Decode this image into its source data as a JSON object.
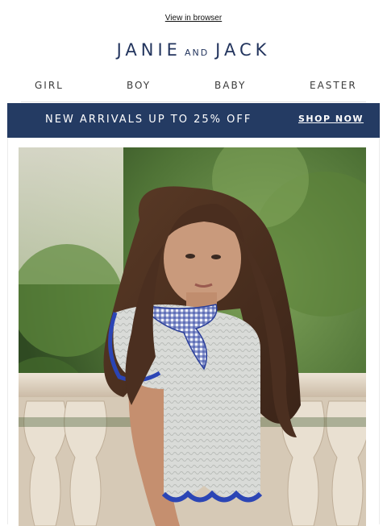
{
  "header": {
    "view_in_browser": "View in browser"
  },
  "brand": {
    "word1": "JANIE",
    "connector": "AND",
    "word2": "JACK",
    "color": "#23355e"
  },
  "nav": {
    "items": [
      {
        "label": "GIRL"
      },
      {
        "label": "BOY"
      },
      {
        "label": "BABY"
      },
      {
        "label": "EASTER"
      }
    ]
  },
  "promo": {
    "message": "NEW ARRIVALS UP TO 25% OFF",
    "cta": "SHOP NOW",
    "background": "#243b63"
  },
  "hero": {
    "icon": "hero-photo"
  }
}
